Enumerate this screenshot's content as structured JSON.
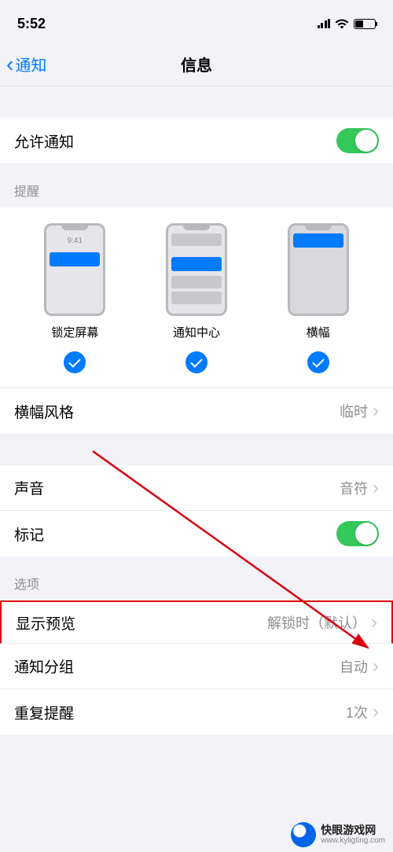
{
  "status": {
    "time": "5:52"
  },
  "nav": {
    "back": "通知",
    "title": "信息"
  },
  "allow": {
    "label": "允许通知"
  },
  "alerts": {
    "header": "提醒",
    "lock_time": "9:41",
    "lockscreen": "锁定屏幕",
    "center": "通知中心",
    "banner": "横幅"
  },
  "banner_style": {
    "label": "横幅风格",
    "value": "临时"
  },
  "sounds": {
    "label": "声音",
    "value": "音符"
  },
  "badges": {
    "label": "标记"
  },
  "options_header": "选项",
  "show_preview": {
    "label": "显示预览",
    "value": "解锁时（默认）"
  },
  "grouping": {
    "label": "通知分组",
    "value": "自动"
  },
  "repeat": {
    "label": "重复提醒",
    "value": "1次"
  },
  "watermark": {
    "title": "快眼游戏网",
    "url": "www.kyligting.com"
  }
}
